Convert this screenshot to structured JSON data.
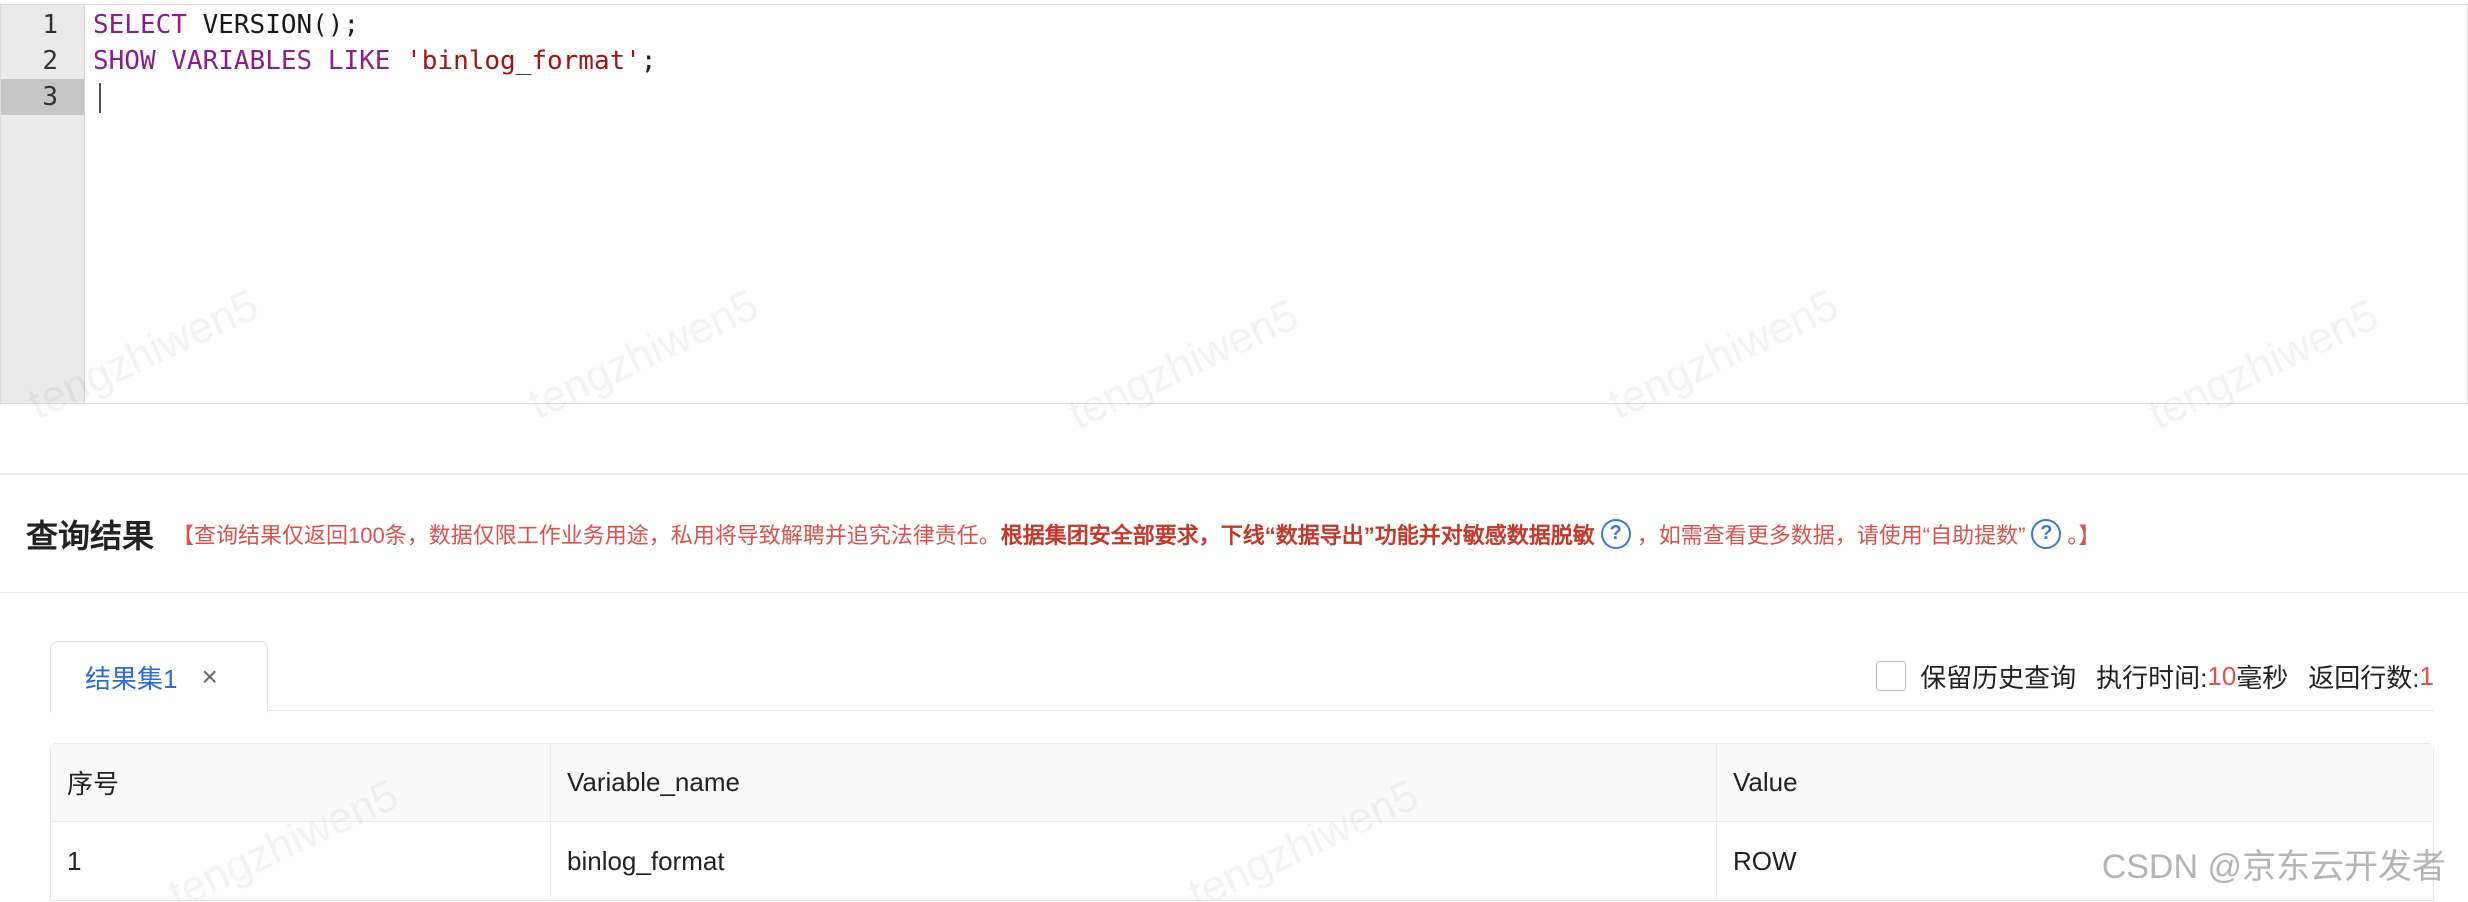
{
  "editor": {
    "line_numbers": [
      "1",
      "2",
      "3"
    ],
    "lines": [
      {
        "parts": [
          {
            "t": "SELECT",
            "k": "kw"
          },
          {
            "t": " VERSION();",
            "k": "plain"
          }
        ]
      },
      {
        "parts": [
          {
            "t": "SHOW",
            "k": "kw"
          },
          {
            "t": " ",
            "k": "plain"
          },
          {
            "t": "VARIABLES",
            "k": "kw"
          },
          {
            "t": " ",
            "k": "plain"
          },
          {
            "t": "LIKE",
            "k": "kw"
          },
          {
            "t": " ",
            "k": "plain"
          },
          {
            "t": "'binlog_format'",
            "k": "str"
          },
          {
            "t": ";",
            "k": "plain"
          }
        ]
      },
      {
        "parts": []
      }
    ],
    "active_line": 3
  },
  "results": {
    "title": "查询结果",
    "notice_part1": "【查询结果仅返回100条，数据仅限工作业务用途，私用将导致解聘并追究法律责任。",
    "notice_bold": "根据集团安全部要求，下线“数据导出”功能并对敏感数据脱敏",
    "notice_part2": "，如需查看更多数据，请使用“自助提数”",
    "notice_end": "。】",
    "help_glyph": "?"
  },
  "tabs": [
    {
      "label": "结果集1",
      "close": "×"
    }
  ],
  "meta": {
    "keep_history_label": "保留历史查询",
    "exec_time_label": "执行时间:",
    "exec_time_value": "10",
    "exec_time_unit": "毫秒",
    "rows_label": "返回行数:",
    "rows_value": "1"
  },
  "table": {
    "columns": [
      "序号",
      "Variable_name",
      "Value"
    ],
    "rows": [
      [
        "1",
        "binlog_format",
        "ROW"
      ]
    ]
  },
  "credit": "CSDN @京东云开发者",
  "watermark": "tengzhiwen5",
  "colors": {
    "keyword": "#8b1e8b",
    "string": "#a31515",
    "link_blue": "#2f6bd6",
    "warning_red": "#d9534f"
  }
}
